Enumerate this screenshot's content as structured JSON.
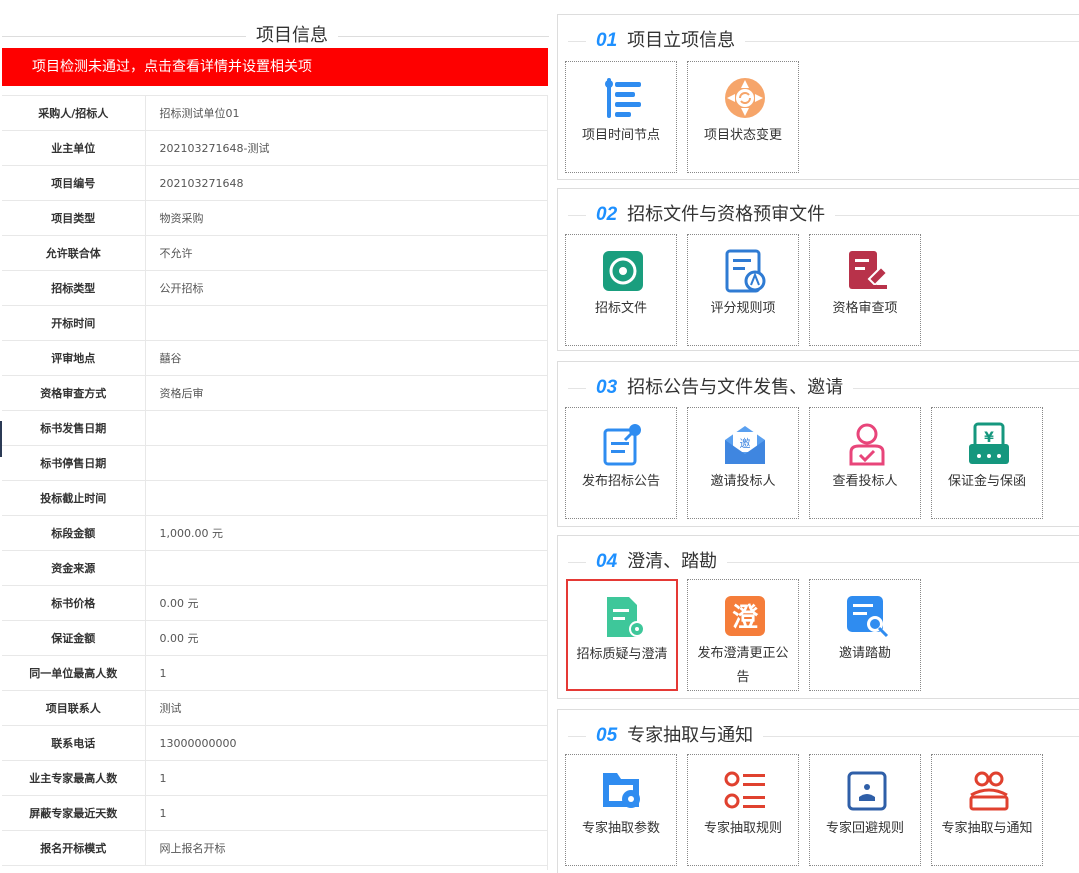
{
  "left": {
    "title": "项目信息",
    "alert": "项目检测未通过，点击查看详情并设置相关项",
    "rows": [
      {
        "label": "采购人/招标人",
        "value": "招标测试单位01"
      },
      {
        "label": "业主单位",
        "value": "202103271648-测试"
      },
      {
        "label": "项目编号",
        "value": "202103271648"
      },
      {
        "label": "项目类型",
        "value": "物资采购"
      },
      {
        "label": "允许联合体",
        "value": "不允许"
      },
      {
        "label": "招标类型",
        "value": "公开招标"
      },
      {
        "label": "开标时间",
        "value": ""
      },
      {
        "label": "评审地点",
        "value": "囍谷"
      },
      {
        "label": "资格审查方式",
        "value": "资格后审"
      },
      {
        "label": "标书发售日期",
        "value": ""
      },
      {
        "label": "标书停售日期",
        "value": ""
      },
      {
        "label": "投标截止时间",
        "value": ""
      },
      {
        "label": "标段金额",
        "value": "1,000.00 元"
      },
      {
        "label": "资金来源",
        "value": ""
      },
      {
        "label": "标书价格",
        "value": "0.00 元"
      },
      {
        "label": "保证金额",
        "value": "0.00 元"
      },
      {
        "label": "同一单位最高人数",
        "value": "1"
      },
      {
        "label": "项目联系人",
        "value": "测试"
      },
      {
        "label": "联系电话",
        "value": "13000000000"
      },
      {
        "label": "业主专家最高人数",
        "value": "1"
      },
      {
        "label": "屏蔽专家最近天数",
        "value": "1"
      },
      {
        "label": "报名开标模式",
        "value": "网上报名开标"
      }
    ]
  },
  "sections": [
    {
      "num": "01",
      "title": "项目立项信息",
      "tiles": [
        {
          "label": "项目时间节点",
          "icon": "timeline-icon"
        },
        {
          "label": "项目状态变更",
          "icon": "status-cycle-icon"
        }
      ]
    },
    {
      "num": "02",
      "title": "招标文件与资格预审文件",
      "tiles": [
        {
          "label": "招标文件",
          "icon": "disc-document-icon"
        },
        {
          "label": "评分规则项",
          "icon": "scoring-rule-icon"
        },
        {
          "label": "资格审查项",
          "icon": "qualification-review-icon"
        }
      ]
    },
    {
      "num": "03",
      "title": "招标公告与文件发售、邀请",
      "tiles": [
        {
          "label": "发布招标公告",
          "icon": "publish-notice-icon"
        },
        {
          "label": "邀请投标人",
          "icon": "invite-envelope-icon"
        },
        {
          "label": "查看投标人",
          "icon": "view-bidder-icon"
        },
        {
          "label": "保证金与保函",
          "icon": "deposit-yen-icon"
        }
      ]
    },
    {
      "num": "04",
      "title": "澄清、踏勘",
      "tiles": [
        {
          "label": "招标质疑与澄清",
          "icon": "doc-gear-icon"
        },
        {
          "label": "发布澄清更正公告",
          "icon": "clarify-char-icon"
        },
        {
          "label": "邀请踏勘",
          "icon": "doc-search-icon"
        }
      ]
    },
    {
      "num": "05",
      "title": "专家抽取与通知",
      "tiles": [
        {
          "label": "专家抽取参数",
          "icon": "folder-gear-icon"
        },
        {
          "label": "专家抽取规则",
          "icon": "list-rule-icon"
        },
        {
          "label": "专家回避规则",
          "icon": "avoid-rule-icon"
        },
        {
          "label": "专家抽取与通知",
          "icon": "group-notify-icon"
        }
      ]
    }
  ],
  "colors": {
    "alert": "#fe0000",
    "section_num": "#1e90ff",
    "active_tile_border": "#e53935"
  }
}
